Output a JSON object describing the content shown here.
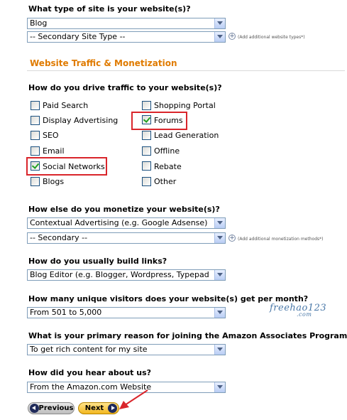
{
  "site_type": {
    "question": "What type of site is your website(s)?",
    "primary_value": "Blog",
    "secondary_value": "-- Secondary Site Type --",
    "add_hint": "(Add additional website types*)"
  },
  "traffic_section": {
    "title": "Website Traffic & Monetization"
  },
  "traffic": {
    "question": "How do you drive traffic to your website(s)?",
    "options_left": [
      {
        "label": "Paid Search",
        "checked": false
      },
      {
        "label": "Display Advertising",
        "checked": false
      },
      {
        "label": "SEO",
        "checked": false
      },
      {
        "label": "Email",
        "checked": false
      },
      {
        "label": "Social Networks",
        "checked": true
      },
      {
        "label": "Blogs",
        "checked": false
      }
    ],
    "options_right": [
      {
        "label": "Shopping Portal",
        "checked": false
      },
      {
        "label": "Forums",
        "checked": true
      },
      {
        "label": "Lead Generation",
        "checked": false
      },
      {
        "label": "Offline",
        "checked": false
      },
      {
        "label": "Rebate",
        "checked": false
      },
      {
        "label": "Other",
        "checked": false
      }
    ]
  },
  "monetize": {
    "question": "How else do you monetize your website(s)?",
    "primary_value": "Contextual Advertising (e.g. Google Adsense)",
    "secondary_value": "-- Secondary --",
    "add_hint": "(Add additional monetization methods*)"
  },
  "links": {
    "question": "How do you usually build links?",
    "value": "Blog Editor (e.g. Blogger, Wordpress, Typepad"
  },
  "visitors": {
    "question": "How many unique visitors does your website(s) get per month?",
    "value": "From 501 to 5,000"
  },
  "reason": {
    "question": "What is your primary reason for joining the Amazon Associates Program?",
    "value": "To get rich content for my site"
  },
  "hear": {
    "question": "How did you hear about us?",
    "value": "From the Amazon.com Website"
  },
  "buttons": {
    "previous": "Previous",
    "next": "Next"
  },
  "watermark": {
    "text": "freehao123",
    "suffix": ".com"
  },
  "colors": {
    "section_title": "#e07b00",
    "highlight_box": "#d9252b",
    "check": "#21a121"
  }
}
